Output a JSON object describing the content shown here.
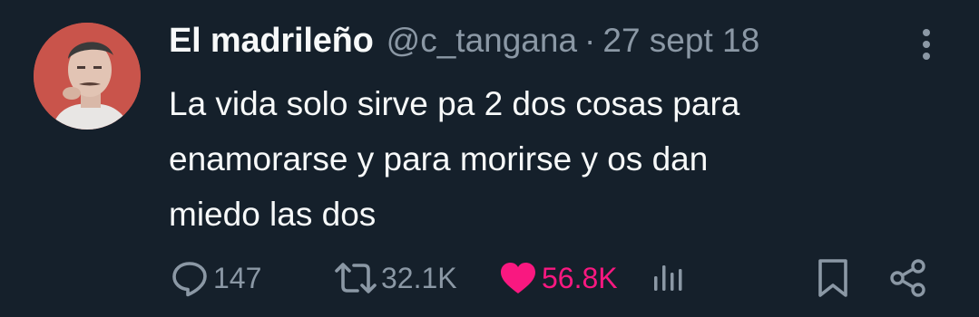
{
  "tweet": {
    "author": {
      "display_name": "El madrileño",
      "handle": "@c_tangana"
    },
    "separator": "·",
    "date": "27 sept 18",
    "text_lines": [
      "La vida solo sirve pa 2 dos cosas para",
      "enamorarse y para morirse y os dan",
      "miedo las dos"
    ],
    "actions": {
      "replies": "147",
      "retweets": "32.1K",
      "likes": "56.8K"
    }
  },
  "colors": {
    "background": "#15202b",
    "text": "#f7f9f9",
    "secondary": "#8b98a5",
    "like": "#f91880"
  },
  "icons": {
    "more": "more-vertical-icon",
    "reply": "reply-icon",
    "retweet": "retweet-icon",
    "like": "heart-icon",
    "views": "views-icon",
    "bookmark": "bookmark-icon",
    "share": "share-icon"
  }
}
